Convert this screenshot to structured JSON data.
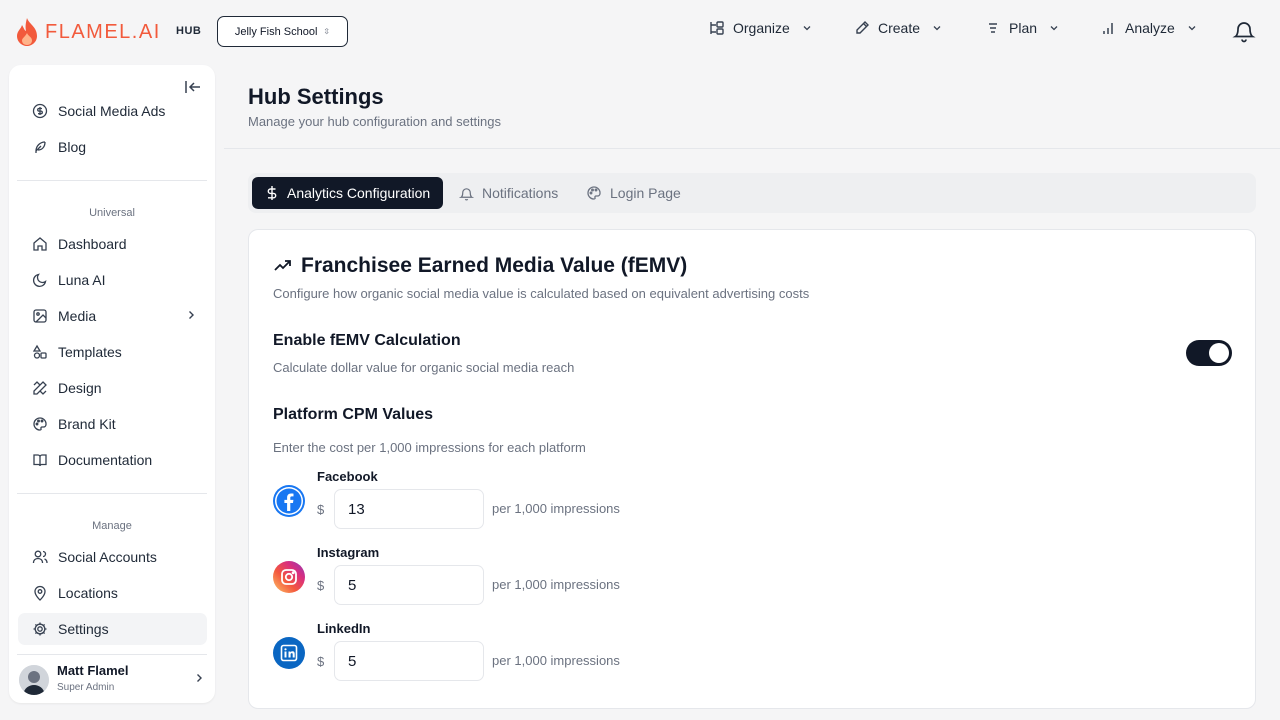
{
  "app": {
    "logo_text": "FLAMEL.AI",
    "hub_tag": "HUB",
    "school_selector": "Jelly Fish School",
    "brand_color": "#f25a3c"
  },
  "topnav": [
    {
      "label": "Organize",
      "icon": "organize-icon"
    },
    {
      "label": "Create",
      "icon": "pen-icon"
    },
    {
      "label": "Plan",
      "icon": "plan-icon"
    },
    {
      "label": "Analyze",
      "icon": "bar-chart-icon"
    }
  ],
  "sidebar": {
    "top_items": [
      {
        "label": "Social Media Ads",
        "icon": "dollar-circle-icon"
      },
      {
        "label": "Blog",
        "icon": "feather-icon"
      }
    ],
    "universal_label": "Universal",
    "universal_items": [
      {
        "label": "Dashboard",
        "icon": "home-icon"
      },
      {
        "label": "Luna AI",
        "icon": "moon-icon"
      },
      {
        "label": "Media",
        "icon": "image-icon"
      },
      {
        "label": "Templates",
        "icon": "shapes-icon"
      },
      {
        "label": "Design",
        "icon": "pencil-ruler-icon"
      },
      {
        "label": "Brand Kit",
        "icon": "palette-icon"
      },
      {
        "label": "Documentation",
        "icon": "book-icon"
      }
    ],
    "manage_label": "Manage",
    "manage_items": [
      {
        "label": "Social Accounts",
        "icon": "users-icon"
      },
      {
        "label": "Locations",
        "icon": "map-pin-icon"
      },
      {
        "label": "Settings",
        "icon": "gear-icon",
        "active": true
      }
    ],
    "user": {
      "name": "Matt Flamel",
      "role": "Super Admin"
    }
  },
  "page": {
    "title": "Hub Settings",
    "subtitle": "Manage your hub configuration and settings"
  },
  "tabs": [
    {
      "label": "Analytics Configuration",
      "icon": "dollar-icon",
      "active": true
    },
    {
      "label": "Notifications",
      "icon": "bell-icon"
    },
    {
      "label": "Login Page",
      "icon": "palette-icon"
    }
  ],
  "card": {
    "title": "Franchisee Earned Media Value (fEMV)",
    "subtitle": "Configure how organic social media value is calculated based on equivalent advertising costs",
    "enable_title": "Enable fEMV Calculation",
    "enable_subtitle": "Calculate dollar value for organic social media reach",
    "enable_on": true,
    "cpm_title": "Platform CPM Values",
    "cpm_subtitle": "Enter the cost per 1,000 impressions for each platform",
    "currency": "$",
    "unit": "per 1,000 impressions",
    "platforms": [
      {
        "name": "Facebook",
        "value": "13",
        "color": "#1877f2"
      },
      {
        "name": "Instagram",
        "value": "5",
        "color": "#e1306c"
      },
      {
        "name": "LinkedIn",
        "value": "5",
        "color": "#0a66c2"
      }
    ]
  }
}
